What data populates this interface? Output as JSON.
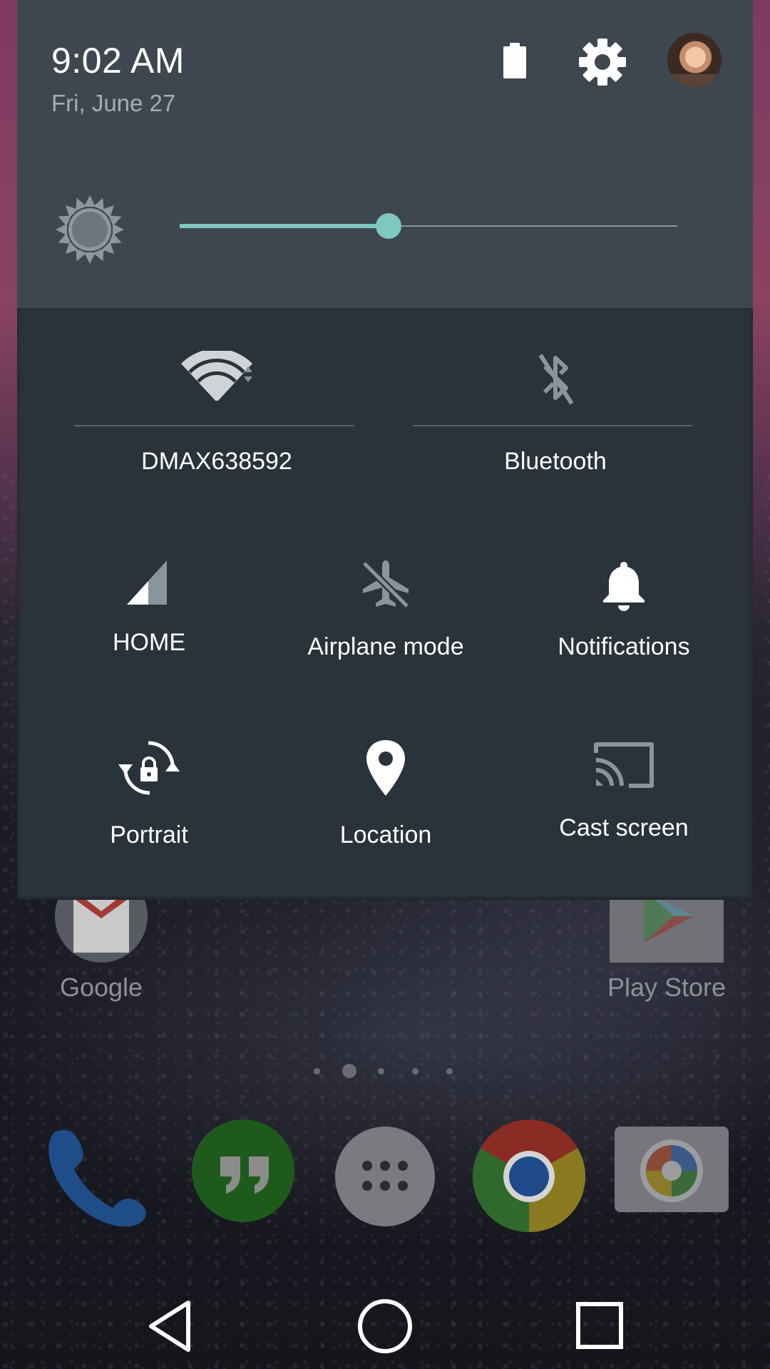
{
  "status": {
    "time": "9:02 AM",
    "date": "Fri, June 27"
  },
  "brightness": {
    "level_fraction": 0.42
  },
  "quick_settings": {
    "wifi_label": "DMAX638592",
    "bluetooth_label": "Bluetooth",
    "cellular_label": "HOME",
    "airplane_label": "Airplane mode",
    "notifications_label": "Notifications",
    "rotation_label": "Portrait",
    "location_label": "Location",
    "cast_label": "Cast screen"
  },
  "home": {
    "apps": [
      {
        "label": "Google"
      },
      {
        "label": "Play Store"
      }
    ],
    "page_count": 5,
    "current_page": 2
  },
  "icons": {
    "battery": "battery-icon",
    "settings": "gear-icon",
    "brightness": "sun-icon",
    "wifi": "wifi-icon",
    "bluetooth": "bluetooth-off-icon",
    "cellular": "signal-icon",
    "airplane": "airplane-off-icon",
    "notifications": "bell-icon",
    "rotation": "rotation-lock-icon",
    "location": "location-pin-icon",
    "cast": "cast-icon"
  },
  "colors": {
    "accent": "#7ec8bf",
    "shade_header": "#3e4650",
    "shade_panel": "#2a323a"
  }
}
